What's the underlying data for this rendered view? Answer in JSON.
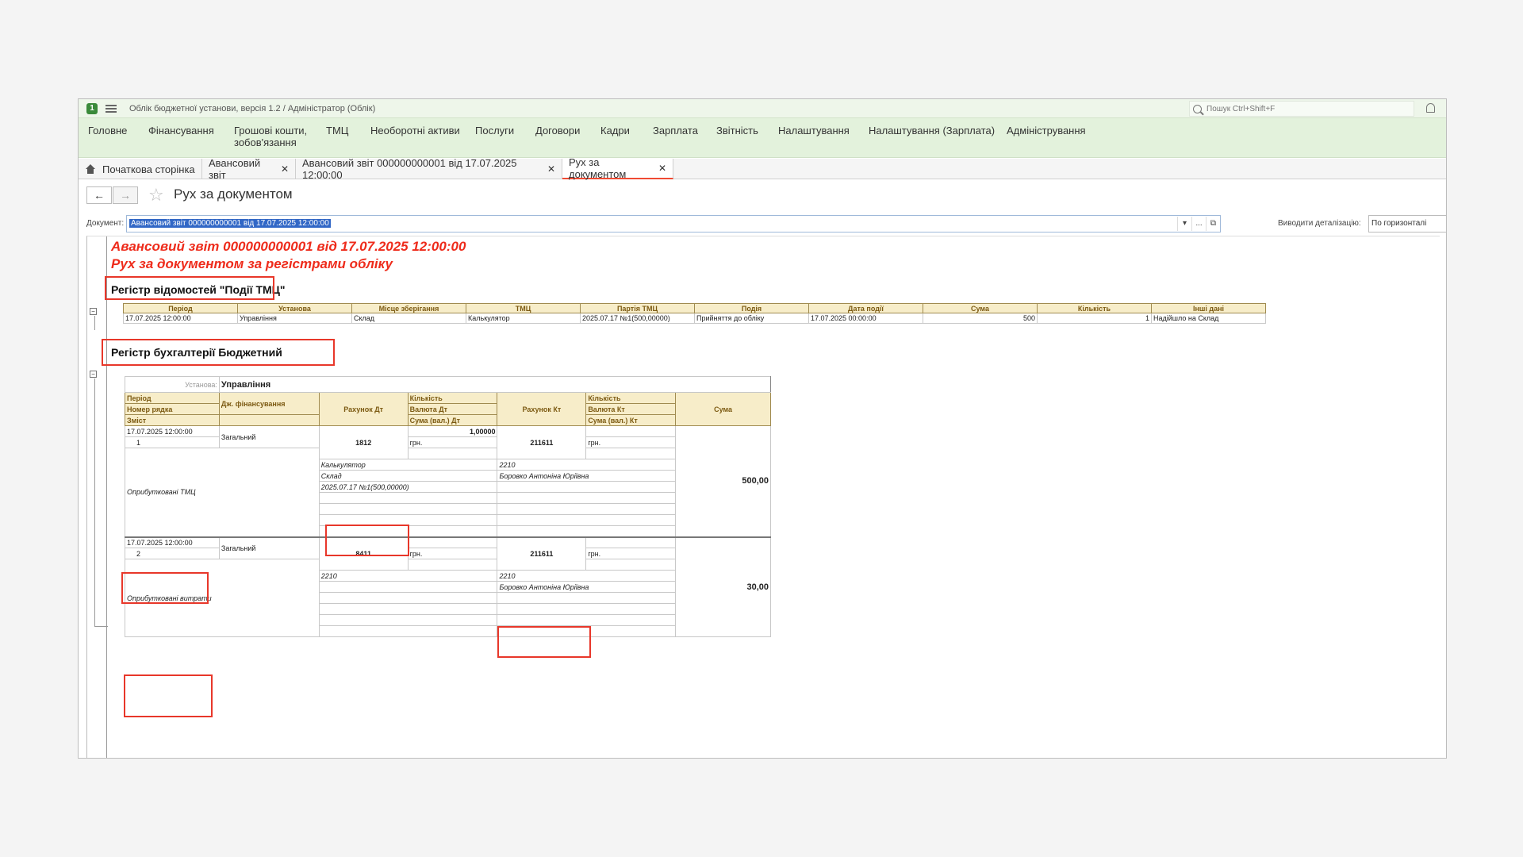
{
  "app": {
    "logo": "1",
    "title": "Облік бюджетної установи, версія 1.2 / Адміністратор  (Облік)",
    "search_placeholder": "Пошук Ctrl+Shift+F"
  },
  "sections": [
    "Головне",
    "Фінансування",
    "Грошові кошти, зобов'язання",
    "ТМЦ",
    "Необоротні активи",
    "Послуги",
    "Договори",
    "Кадри",
    "Зарплата",
    "Звітність",
    "Налаштування",
    "Налаштування (Зарплата)",
    "Адміністрування"
  ],
  "tabs": [
    {
      "label": "Початкова сторінка"
    },
    {
      "label": "Авансовий звіт"
    },
    {
      "label": "Авансовий звіт 000000000001 від 17.07.2025 12:00:00"
    },
    {
      "label": "Рух за документом"
    }
  ],
  "toolbar": {
    "back": "←",
    "forward": "→",
    "star": "☆",
    "title": "Рух за документом"
  },
  "document": {
    "label": "Документ:",
    "value": "Авансовий звіт 000000000001 від 17.07.2025 12:00:00",
    "btn_dropdown": "▾",
    "btn_more": "...",
    "btn_open": "⧉",
    "detail_label": "Виводити деталізацію:",
    "detail_value": "По горизонталі",
    "detail_arrow": "▾"
  },
  "report": {
    "title1": "Авансовий звіт 000000000001 від 17.07.2025 12:00:00",
    "title2": "Рух за документом за регістрами обліку",
    "collapse": "−",
    "reg1": {
      "title": "Регістр відомостей \"Події ТМЦ\"",
      "headers": [
        "Період",
        "Установа",
        "Місце зберігання",
        "ТМЦ",
        "Партія ТМЦ",
        "Подія",
        "Дата події",
        "Сума",
        "Кількість",
        "Інші дані"
      ],
      "rows": [
        [
          "17.07.2025 12:00:00",
          "Управління",
          "Склад",
          "Калькулятор",
          "2025.07.17 №1(500,00000)",
          "Прийняття до обліку",
          "17.07.2025 00:00:00",
          "500",
          "1",
          "Надійшло на Склад"
        ]
      ]
    },
    "reg2": {
      "title": "Регістр бухгалтерії Бюджетний",
      "org_label": "Установа:",
      "org_value": "Управління",
      "h_period": "Період",
      "h_rownum": "Номер рядка",
      "h_content": "Зміст",
      "h_fund": "Дж. фінансування",
      "h_dt": "Рахунок Дт",
      "h_qty_dt": "Кількість",
      "h_cur_dt": "Валюта Дт",
      "h_sumcur_dt": "Сума (вал.) Дт",
      "h_kt": "Рахунок Кт",
      "h_qty_kt": "Кількість",
      "h_cur_kt": "Валюта Кт",
      "h_sumcur_kt": "Сума (вал.) Кт",
      "h_sum": "Сума",
      "entries": [
        {
          "period": "17.07.2025 12:00:00",
          "num": "1",
          "fund": "Загальний",
          "dt": "1812",
          "qty_dt": "1,00000",
          "cur_dt": "грн.",
          "kt": "211611",
          "cur_kt": "грн.",
          "sub_dt": [
            "Калькулятор",
            "Склад",
            "2025.07.17 №1(500,00000)"
          ],
          "sub_kt": [
            "2210",
            "Боровко Антоніна Юріївна"
          ],
          "content": "Оприбутковані ТМЦ",
          "sum": "500,00"
        },
        {
          "period": "17.07.2025 12:00:00",
          "num": "2",
          "fund": "Загальний",
          "dt": "8411",
          "qty_dt": "",
          "cur_dt": "грн.",
          "kt": "211611",
          "cur_kt": "грн.",
          "sub_dt": [
            "2210"
          ],
          "sub_kt": [
            "2210",
            "Боровко Антоніна Юріївна"
          ],
          "content": "Оприбутковані витрати",
          "sum": "30,00"
        }
      ]
    }
  }
}
